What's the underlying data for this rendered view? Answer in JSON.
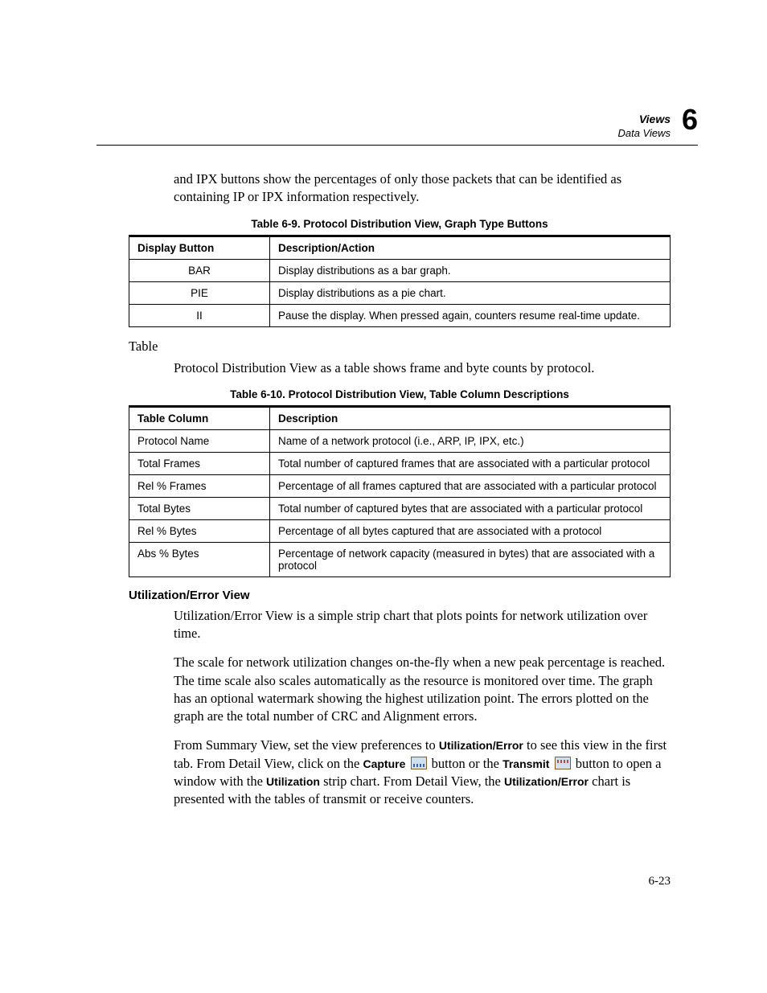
{
  "header": {
    "title": "Views",
    "subtitle": "Data Views",
    "chapter_number": "6"
  },
  "intro_paragraph": "and IPX buttons show the percentages of only those packets that can be identified as containing IP or IPX information respectively.",
  "table9": {
    "caption": "Table 6-9. Protocol Distribution View, Graph Type Buttons",
    "head": {
      "c1": "Display Button",
      "c2": "Description/Action"
    },
    "rows": [
      {
        "c1": "BAR",
        "c2": "Display distributions as a bar graph."
      },
      {
        "c1": "PIE",
        "c2": "Display distributions as a pie chart."
      },
      {
        "c1": "II",
        "c2": "Pause the display. When pressed again, counters resume real-time update."
      }
    ]
  },
  "side_heading": "Table",
  "table_intro": "Protocol Distribution View as a table shows frame and byte counts by protocol.",
  "table10": {
    "caption": "Table 6-10. Protocol Distribution View, Table Column Descriptions",
    "head": {
      "c1": "Table Column",
      "c2": "Description"
    },
    "rows": [
      {
        "c1": "Protocol Name",
        "c2": "Name of a network protocol (i.e., ARP, IP, IPX, etc.)"
      },
      {
        "c1": "Total Frames",
        "c2": "Total number of captured frames that are associated with a particular protocol"
      },
      {
        "c1": "Rel % Frames",
        "c2": "Percentage of all frames captured that are associated with a particular protocol"
      },
      {
        "c1": "Total Bytes",
        "c2": "Total number of captured bytes that are associated with a particular protocol"
      },
      {
        "c1": "Rel % Bytes",
        "c2": "Percentage of all bytes captured that are associated with a protocol"
      },
      {
        "c1": "Abs % Bytes",
        "c2": "Percentage of network capacity (measured in bytes) that are associated with a protocol"
      }
    ]
  },
  "section": {
    "heading": "Utilization/Error View",
    "p1": "Utilization/Error View is a simple strip chart that plots points for network utilization over time.",
    "p2": "The scale for network utilization changes on-the-fly when a new peak percentage is reached. The time scale also scales automatically as the resource is monitored over time. The graph has an optional watermark showing the highest utilization point. The errors plotted on the graph are the total number of CRC and Alignment errors.",
    "p3": {
      "t1": "From Summary View, set the view preferences to ",
      "b1": "Utilization/Error",
      "t2": " to see this view in the first tab. From Detail View, click on the ",
      "b2": "Capture",
      "t3": " button or the ",
      "b3": "Transmit",
      "t4": " button to open a window with the ",
      "b4": "Utilization",
      "t5": " strip chart. From Detail View, the ",
      "b5": "Utilization/Error",
      "t6": " chart is presented with the tables of transmit or receive counters."
    }
  },
  "page_number": "6-23"
}
